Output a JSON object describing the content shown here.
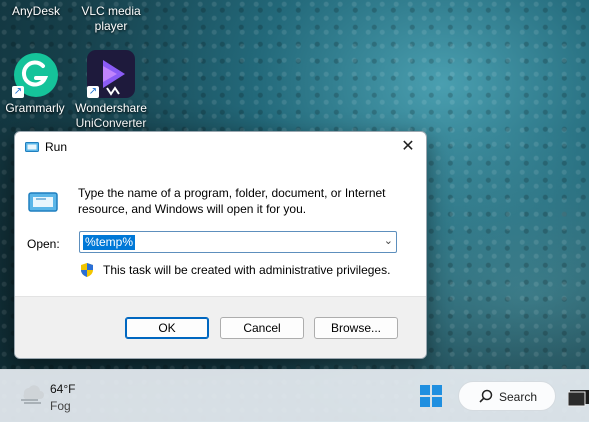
{
  "desktop": {
    "icons": [
      {
        "label": "AnyDesk"
      },
      {
        "label": "VLC media player"
      },
      {
        "label": "Grammarly"
      },
      {
        "label": "Wondershare UniConverter"
      }
    ]
  },
  "run_dialog": {
    "title": "Run",
    "description": "Type the name of a program, folder, document, or Internet resource, and Windows will open it for you.",
    "open_label": "Open:",
    "open_value": "%temp%",
    "admin_note": "This task will be created with administrative privileges.",
    "buttons": {
      "ok": "OK",
      "cancel": "Cancel",
      "browse": "Browse..."
    }
  },
  "taskbar": {
    "weather": {
      "temp": "64°F",
      "condition": "Fog"
    },
    "search_label": "Search"
  },
  "colors": {
    "accent": "#0078d7",
    "grammarly": "#15c39a",
    "uniconverter": "#6a3df0"
  }
}
